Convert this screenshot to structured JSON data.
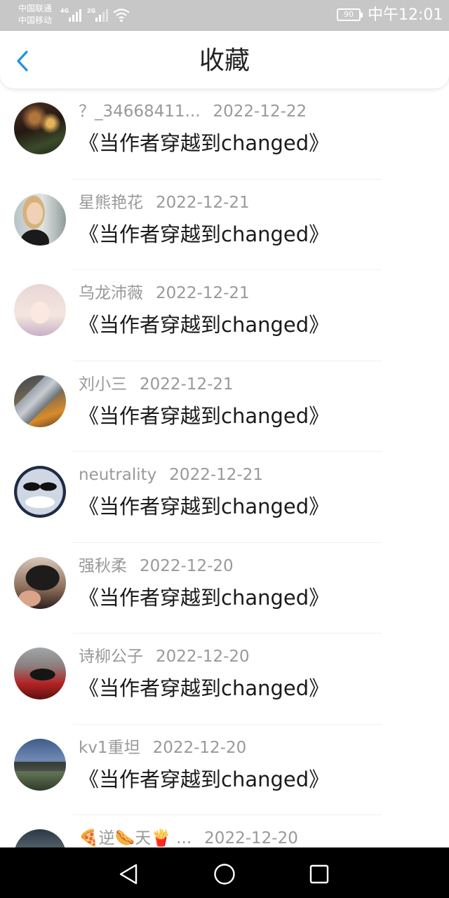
{
  "status_bar": {
    "carrier_1": "中国联通",
    "carrier_2": "中国移动",
    "net_1": "4G",
    "net_2": "2G",
    "battery": "90",
    "time": "中午12:01"
  },
  "header": {
    "title": "收藏",
    "back_icon": "chevron-left-icon",
    "accent": "#1e90e8"
  },
  "favorites": [
    {
      "user": "？_34668411...",
      "date": "2022-12-22",
      "book": "《当作者穿越到changed》",
      "avatar": "restaurant-photo"
    },
    {
      "user": "星熊艳花",
      "date": "2022-12-21",
      "book": "《当作者穿越到changed》",
      "avatar": "woman-photo"
    },
    {
      "user": "乌龙沛薇",
      "date": "2022-12-21",
      "book": "《当作者穿越到changed》",
      "avatar": "anime-girl"
    },
    {
      "user": "刘小三",
      "date": "2022-12-21",
      "book": "《当作者穿越到changed》",
      "avatar": "spaceship"
    },
    {
      "user": "neutrality",
      "date": "2022-12-21",
      "book": "《当作者穿越到changed》",
      "avatar": "grinning-skull"
    },
    {
      "user": "强秋柔",
      "date": "2022-12-20",
      "book": "《当作者穿越到changed》",
      "avatar": "cat-photo"
    },
    {
      "user": "诗柳公子",
      "date": "2022-12-20",
      "book": "《当作者穿越到changed》",
      "avatar": "lying-figure"
    },
    {
      "user": "kv1重坦",
      "date": "2022-12-20",
      "book": "《当作者穿越到changed》",
      "avatar": "tank"
    },
    {
      "user": "🍕逆🌭天🍟 ...",
      "date": "2022-12-20",
      "book": "",
      "avatar": "scene"
    }
  ],
  "nav": {
    "back_icon": "triangle-back-icon",
    "home_icon": "circle-home-icon",
    "recent_icon": "square-recent-icon"
  }
}
